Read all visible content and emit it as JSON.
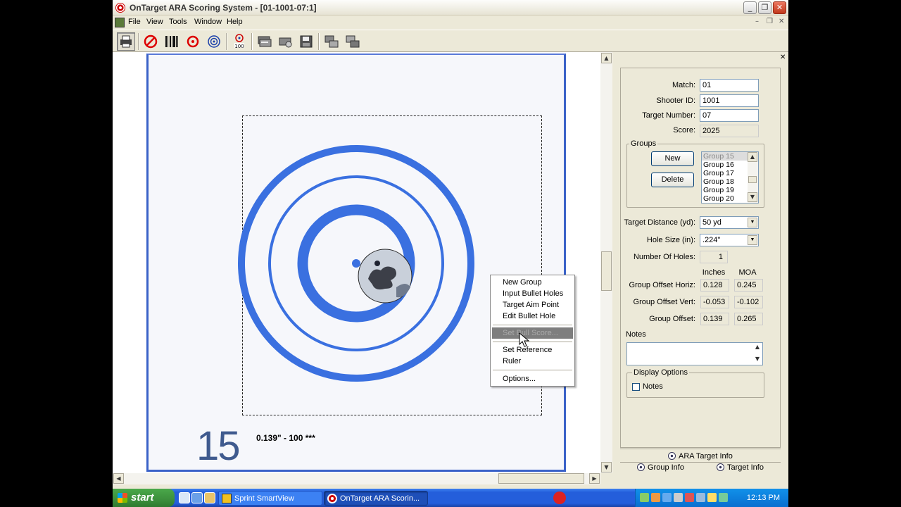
{
  "window": {
    "title": "OnTarget ARA Scoring System - [01-1001-07:1]",
    "caption_buttons": [
      "_",
      "❐",
      "✕"
    ]
  },
  "menu": {
    "items": [
      "File",
      "View",
      "Tools",
      "Window",
      "Help"
    ],
    "mdi_buttons": [
      "–",
      "❐",
      "✕"
    ]
  },
  "toolbar": {
    "buttons": [
      "printer-icon",
      "no-entry-icon",
      "barcode-icon",
      "red-target-icon",
      "blue-target-icon",
      "score-100-icon",
      "scan-stack-icon",
      "scan-settings-icon",
      "save-icon",
      "copy-targets-icon",
      "paste-targets-icon"
    ]
  },
  "target": {
    "number": "15",
    "group_caption": "0.139\" - 100 ***",
    "colors": {
      "ring": "#3a70e0",
      "ink": "#3a62c8"
    }
  },
  "context_menu": {
    "items": [
      "New Group",
      "Input Bullet Holes",
      "Target Aim Point",
      "Edit Bullet Hole",
      "Set Bull Score...",
      "Set Reference",
      "Ruler",
      "Options..."
    ]
  },
  "panel": {
    "fields": {
      "match": {
        "label": "Match:",
        "value": "01"
      },
      "shooter_id": {
        "label": "Shooter ID:",
        "value": "1001"
      },
      "target_number": {
        "label": "Target Number:",
        "value": "07"
      },
      "score": {
        "label": "Score:",
        "value": "2025"
      }
    },
    "groups": {
      "legend": "Groups",
      "new_label": "New",
      "delete_label": "Delete",
      "list": [
        "Group 15",
        "Group 16",
        "Group 17",
        "Group 18",
        "Group 19",
        "Group 20"
      ]
    },
    "target_distance": {
      "label": "Target Distance (yd):",
      "value": "50 yd"
    },
    "hole_size": {
      "label": "Hole Size (in):",
      "value": ".224\""
    },
    "number_of_holes": {
      "label": "Number Of Holes:",
      "value": "1"
    },
    "columns": {
      "inches": "Inches",
      "moa": "MOA"
    },
    "offsets": [
      {
        "label": "Group Offset Horiz:",
        "inches": "0.128",
        "moa": "0.245"
      },
      {
        "label": "Group Offset Vert:",
        "inches": "-0.053",
        "moa": "-0.102"
      },
      {
        "label": "Group Offset:",
        "inches": "0.139",
        "moa": "0.265"
      }
    ],
    "notes_label": "Notes",
    "display_options": {
      "legend": "Display Options",
      "notes_checkbox": "Notes"
    },
    "tabs": {
      "ara": "ARA Target Info",
      "group_info": "Group Info",
      "target_info": "Target Info"
    }
  },
  "taskbar": {
    "start": "start",
    "tasks": [
      "Sprint SmartView",
      "OnTarget ARA Scorin..."
    ],
    "clock": "12:13 PM"
  }
}
